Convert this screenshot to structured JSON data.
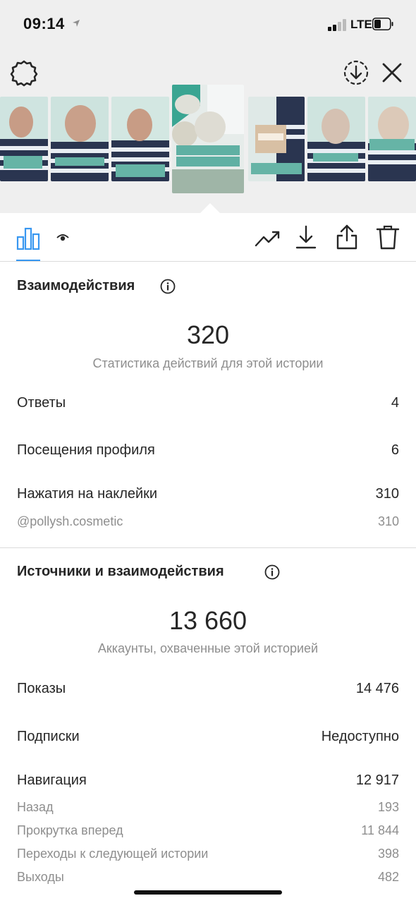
{
  "status_bar": {
    "time": "09:14",
    "network": "LTE"
  },
  "stats": {
    "interactions": {
      "title": "Взаимодействия",
      "total": "320",
      "caption": "Статистика действий для этой истории",
      "rows": [
        {
          "label": "Ответы",
          "value": "4"
        },
        {
          "label": "Посещения профиля",
          "value": "6"
        },
        {
          "label": "Нажатия на наклейки",
          "value": "310"
        }
      ],
      "sticker": {
        "label": "@pollysh.cosmetic",
        "value": "310"
      }
    },
    "discovery": {
      "title": "Источники и взаимодействия",
      "total": "13 660",
      "caption": "Аккаунты, охваченные этой историей",
      "rows": [
        {
          "label": "Показы",
          "value": "14 476"
        },
        {
          "label": "Подписки",
          "value": "Недоступно"
        },
        {
          "label": "Навигация",
          "value": "12 917"
        }
      ],
      "navigation": [
        {
          "label": "Назад",
          "value": "193"
        },
        {
          "label": "Прокрутка вперед",
          "value": "11 844"
        },
        {
          "label": "Переходы к следующей истории",
          "value": "398"
        },
        {
          "label": "Выходы",
          "value": "482"
        }
      ]
    }
  },
  "icons": {
    "settings": "gear-icon",
    "save_story": "download-circle-icon",
    "close": "close-icon",
    "insights_tab": "bar-chart-icon",
    "viewers_tab": "eye-icon",
    "promote": "trend-up-icon",
    "download": "download-icon",
    "share": "share-icon",
    "delete": "trash-icon",
    "info": "info-icon"
  },
  "colors": {
    "accent": "#3897f0",
    "text": "#262626",
    "muted": "#8e8e8e",
    "divider": "#dbdbdb"
  }
}
